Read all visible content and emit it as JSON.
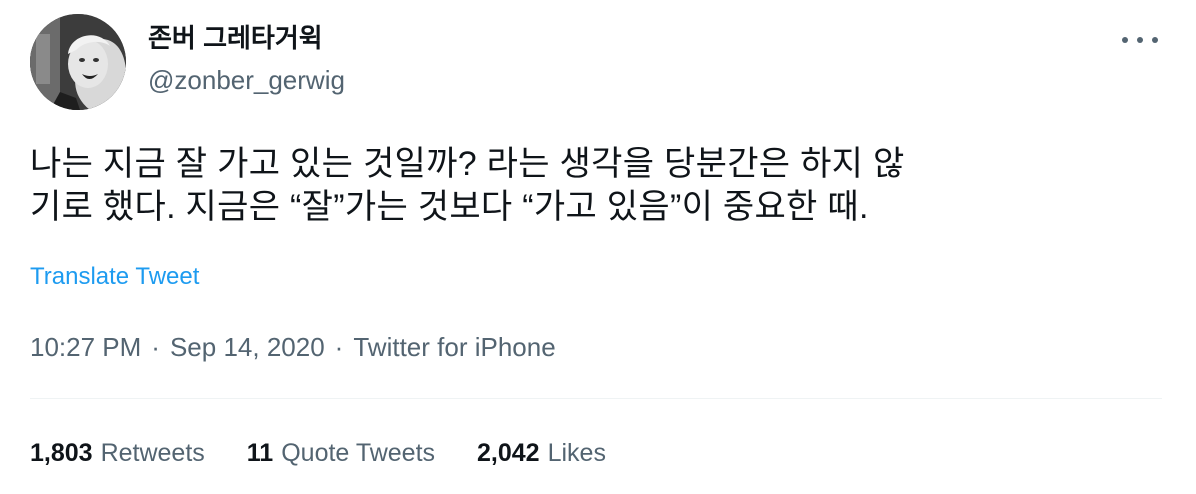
{
  "user": {
    "display_name": "존버 그레타거윅",
    "handle": "@zonber_gerwig"
  },
  "more_icon": "more-horizontal-icon",
  "tweet": {
    "text_lines": [
      "나는 지금 잘 가고 있는 것일까? 라는 생각을 당분간은 하지 않",
      "기로 했다. 지금은 “잘”가는 것보다 “가고 있음”이 중요한 때."
    ],
    "translate_label": "Translate Tweet"
  },
  "meta": {
    "time": "10:27 PM",
    "separator": "·",
    "date": "Sep 14, 2020",
    "source": "Twitter for iPhone"
  },
  "stats": {
    "retweets": {
      "count": "1,803",
      "label": "Retweets"
    },
    "quotes": {
      "count": "11",
      "label": "Quote Tweets"
    },
    "likes": {
      "count": "2,042",
      "label": "Likes"
    }
  },
  "colors": {
    "link": "#1d9bf0",
    "secondary_text": "#536471",
    "primary_text": "#0f1419",
    "divider": "#eff3f4"
  }
}
